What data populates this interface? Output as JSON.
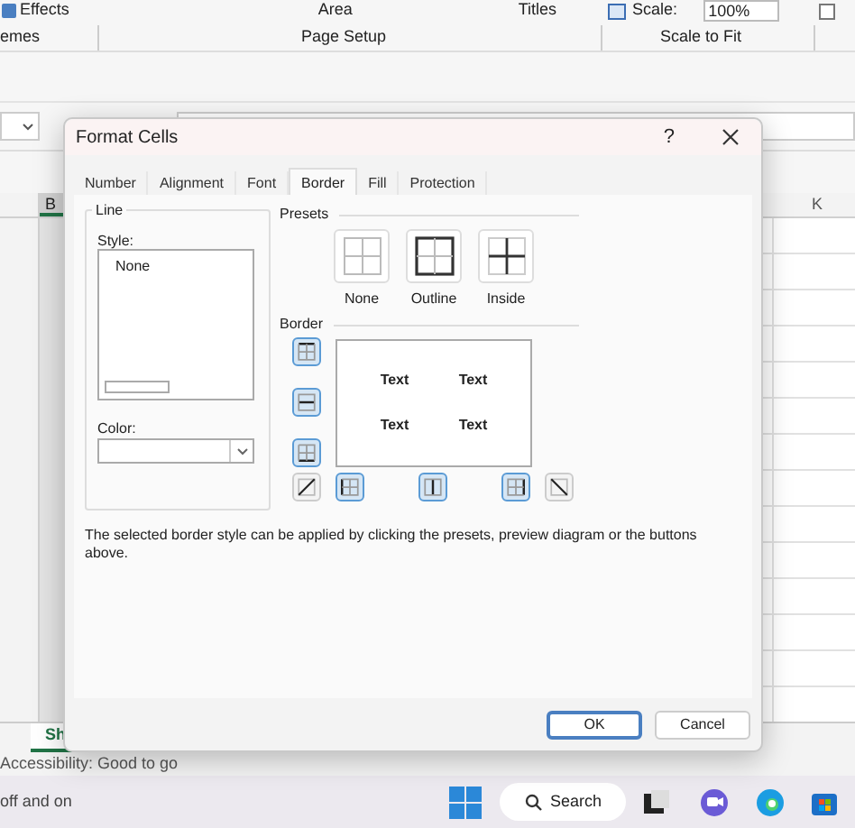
{
  "ribbon": {
    "effects": "Effects",
    "themes_group": "emes",
    "area": "Area",
    "page_setup": "Page Setup",
    "titles": "Titles",
    "scale_label": "Scale:",
    "scale_value": "100%",
    "scale_to_fit": "Scale to Fit",
    "checkbox": {
      "checked": false
    }
  },
  "column_headers": [
    "B",
    "K"
  ],
  "sheet_tab": "Sh",
  "status_bar": "Accessibility: Good to go",
  "taskbar": {
    "notice": "off and on",
    "search": "Search"
  },
  "dialog": {
    "title": "Format Cells",
    "help": "?",
    "tabs": [
      {
        "label": "Number",
        "selected": false
      },
      {
        "label": "Alignment",
        "selected": false
      },
      {
        "label": "Font",
        "selected": false
      },
      {
        "label": "Border",
        "selected": true
      },
      {
        "label": "Fill",
        "selected": false
      },
      {
        "label": "Protection",
        "selected": false
      }
    ],
    "line": {
      "title": "Line",
      "style_label": "Style:",
      "styles": [
        "None"
      ],
      "color_label": "Color:"
    },
    "presets": {
      "title": "Presets",
      "items": [
        {
          "label": "None",
          "kind": "none"
        },
        {
          "label": "Outline",
          "kind": "outline"
        },
        {
          "label": "Inside",
          "kind": "inside"
        }
      ]
    },
    "border": {
      "title": "Border",
      "preview_texts": [
        "Text",
        "Text",
        "Text",
        "Text"
      ],
      "side_buttons": [
        {
          "kind": "top",
          "on": true
        },
        {
          "kind": "middle",
          "on": true
        },
        {
          "kind": "bottom",
          "on": true
        }
      ],
      "bottom_buttons": [
        {
          "kind": "diag-up",
          "on": false
        },
        {
          "kind": "left",
          "on": true
        },
        {
          "kind": "center",
          "on": true
        },
        {
          "kind": "right",
          "on": true
        },
        {
          "kind": "diag-down",
          "on": false
        }
      ]
    },
    "description": "The selected border style can be applied by clicking the presets, preview diagram or the buttons above.",
    "buttons": [
      {
        "label": "OK",
        "kind": "default"
      },
      {
        "label": "Cancel",
        "kind": "normal"
      }
    ]
  }
}
